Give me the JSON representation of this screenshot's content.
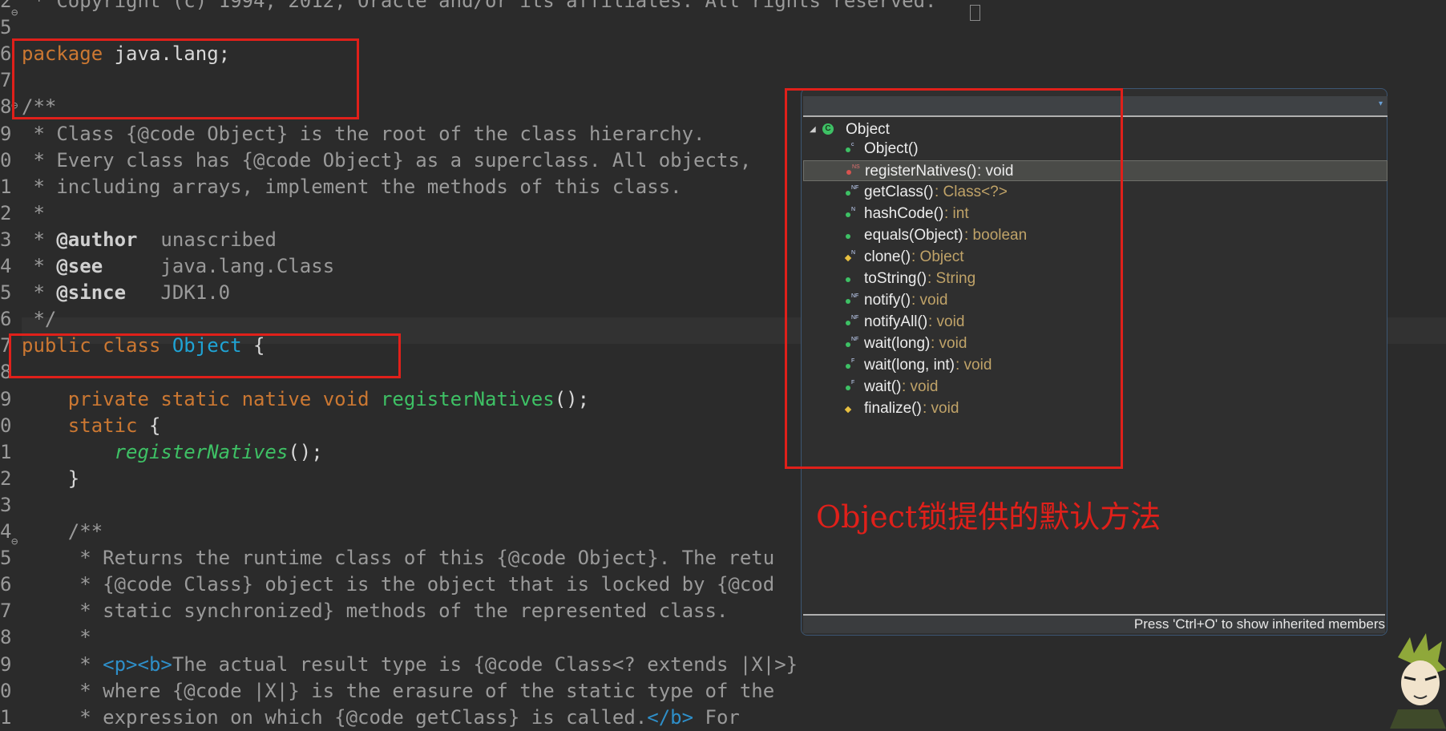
{
  "code": {
    "lines": [
      {
        "num": "2",
        "html": "<span class=\"cm\"> * Copyright (c) 1994, 2012, Oracle and/or its affiliates. All rights reserved.</span>"
      },
      {
        "num": "5",
        "html": ""
      },
      {
        "num": "6",
        "html": "<span class=\"kw\">package</span> java.lang;"
      },
      {
        "num": "7",
        "html": ""
      },
      {
        "num": "8",
        "html": "<span class=\"cm\">/**</span>"
      },
      {
        "num": "9",
        "html": "<span class=\"cm\"> * Class {@code Object} is the root of the class hierarchy.</span>"
      },
      {
        "num": "0",
        "html": "<span class=\"cm\"> * Every class has {@code Object} as a superclass. All objects,</span>"
      },
      {
        "num": "1",
        "html": "<span class=\"cm\"> * including arrays, implement the methods of this class.</span>"
      },
      {
        "num": "2",
        "html": "<span class=\"cm\"> *</span>"
      },
      {
        "num": "3",
        "html": "<span class=\"cm\"> * </span><span class=\"tag\">@author</span><span class=\"cm\">  unascribed</span>"
      },
      {
        "num": "4",
        "html": "<span class=\"cm\"> * </span><span class=\"tag\">@see</span><span class=\"cm\">     java.lang.Class</span>"
      },
      {
        "num": "5",
        "html": "<span class=\"cm\"> * </span><span class=\"tag\">@since</span><span class=\"cm\">   JDK1.0</span>"
      },
      {
        "num": "6",
        "html": "<span class=\"cm\"> */</span>"
      },
      {
        "num": "7",
        "html": "<span class=\"kw\">public</span> <span class=\"kw\">class</span> <span class=\"cls\">Object</span> {"
      },
      {
        "num": "8",
        "html": ""
      },
      {
        "num": "9",
        "html": "    <span class=\"kw\">private</span> <span class=\"kw\">static</span> <span class=\"kw\">native</span> <span class=\"kw\">void</span> <span class=\"fn\">registerNatives</span>();"
      },
      {
        "num": "0",
        "html": "    <span class=\"kw\">static</span> {"
      },
      {
        "num": "1",
        "html": "        <span class=\"fni\">registerNatives</span>();"
      },
      {
        "num": "2",
        "html": "    }"
      },
      {
        "num": "3",
        "html": ""
      },
      {
        "num": "4",
        "html": "    <span class=\"cm\">/**</span>"
      },
      {
        "num": "5",
        "html": "<span class=\"cm\">     * Returns the runtime class of this {@code Object}. The retu</span>"
      },
      {
        "num": "6",
        "html": "<span class=\"cm\">     * {@code Class} object is the object that is locked by {@cod</span>"
      },
      {
        "num": "7",
        "html": "<span class=\"cm\">     * static synchronized} methods of the represented class.</span>"
      },
      {
        "num": "8",
        "html": "<span class=\"cm\">     *</span>"
      },
      {
        "num": "9",
        "html": "<span class=\"cm\">     * </span><span class=\"htag\">&lt;p&gt;&lt;b&gt;</span><span class=\"cm\">The actual result type is {@code Class&lt;? extends |X|&gt;}</span>"
      },
      {
        "num": "0",
        "html": "<span class=\"cm\">     * where {@code |X|} is the erasure of the static type of the</span>"
      },
      {
        "num": "1",
        "html": "<span class=\"cm\">     * expression on which {@code getClass} is called.</span><span class=\"htag\">&lt;/b&gt;</span><span class=\"cm\"> For</span>"
      }
    ]
  },
  "outline": {
    "root": "Object",
    "items": [
      {
        "name": "Object()",
        "type": "",
        "icon": "constructor",
        "color": "#3ec165",
        "sup": "c"
      },
      {
        "name": "registerNatives()",
        "type": ": void",
        "icon": "private-static-native",
        "color": "#d9534f",
        "sup": "NS",
        "selected": true
      },
      {
        "name": "getClass()",
        "type": ": Class<?>",
        "icon": "public-final-native",
        "color": "#3ec165",
        "sup": "NF"
      },
      {
        "name": "hashCode()",
        "type": ": int",
        "icon": "public-native",
        "color": "#3ec165",
        "sup": "N"
      },
      {
        "name": "equals(Object)",
        "type": ": boolean",
        "icon": "public",
        "color": "#3ec165",
        "sup": ""
      },
      {
        "name": "clone()",
        "type": ": Object",
        "icon": "protected-native",
        "color": "#e8c040",
        "sup": "N"
      },
      {
        "name": "toString()",
        "type": ": String",
        "icon": "public",
        "color": "#3ec165",
        "sup": ""
      },
      {
        "name": "notify()",
        "type": ": void",
        "icon": "public-final-native",
        "color": "#3ec165",
        "sup": "NF"
      },
      {
        "name": "notifyAll()",
        "type": ": void",
        "icon": "public-final-native",
        "color": "#3ec165",
        "sup": "NF"
      },
      {
        "name": "wait(long)",
        "type": ": void",
        "icon": "public-final-native",
        "color": "#3ec165",
        "sup": "NF"
      },
      {
        "name": "wait(long, int)",
        "type": ": void",
        "icon": "public-final",
        "color": "#3ec165",
        "sup": "F"
      },
      {
        "name": "wait()",
        "type": ": void",
        "icon": "public-final",
        "color": "#3ec165",
        "sup": "F"
      },
      {
        "name": "finalize()",
        "type": ": void",
        "icon": "protected",
        "color": "#e8c040",
        "sup": ""
      }
    ],
    "footer": "Press 'Ctrl+O' to show inherited members"
  },
  "annotation": "Object锁提供的默认方法"
}
